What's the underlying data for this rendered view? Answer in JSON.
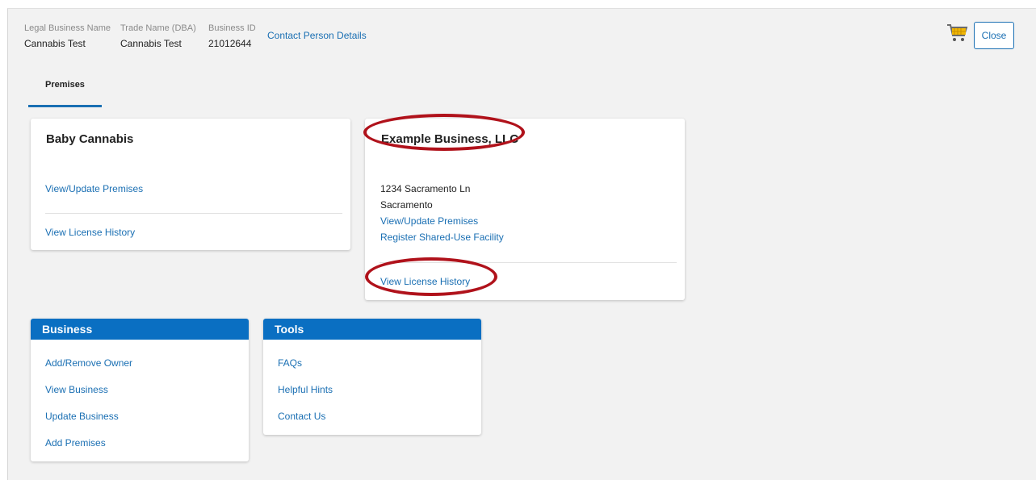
{
  "header": {
    "legal_name_label": "Legal Business Name",
    "legal_name_value": "Cannabis Test",
    "trade_name_label": "Trade Name (DBA)",
    "trade_name_value": "Cannabis Test",
    "business_id_label": "Business ID",
    "business_id_value": "21012644",
    "contact_link": "Contact Person Details",
    "cart_icon": "shopping-cart-icon",
    "close_label": "Close"
  },
  "tabs": [
    {
      "label": "Premises",
      "active": true
    }
  ],
  "premises": [
    {
      "name": "Baby Cannabis",
      "update_link": "View/Update Premises",
      "history_link": "View License History"
    },
    {
      "name": "Example Business, LLC",
      "address_line1": "1234 Sacramento Ln",
      "address_line2": "Sacramento",
      "update_link": "View/Update Premises",
      "shared_use_link": "Register Shared-Use Facility",
      "history_link": "View License History"
    }
  ],
  "business_panel": {
    "title": "Business",
    "items": [
      "Add/Remove Owner",
      "View Business",
      "Update Business",
      "Add Premises"
    ]
  },
  "tools_panel": {
    "title": "Tools",
    "items": [
      "FAQs",
      "Helpful Hints",
      "Contact Us"
    ]
  },
  "colors": {
    "link": "#1a6fb3",
    "panel_header": "#0a6fc2",
    "highlight_oval": "#b0121b",
    "page_bg": "#f2f2f2"
  }
}
